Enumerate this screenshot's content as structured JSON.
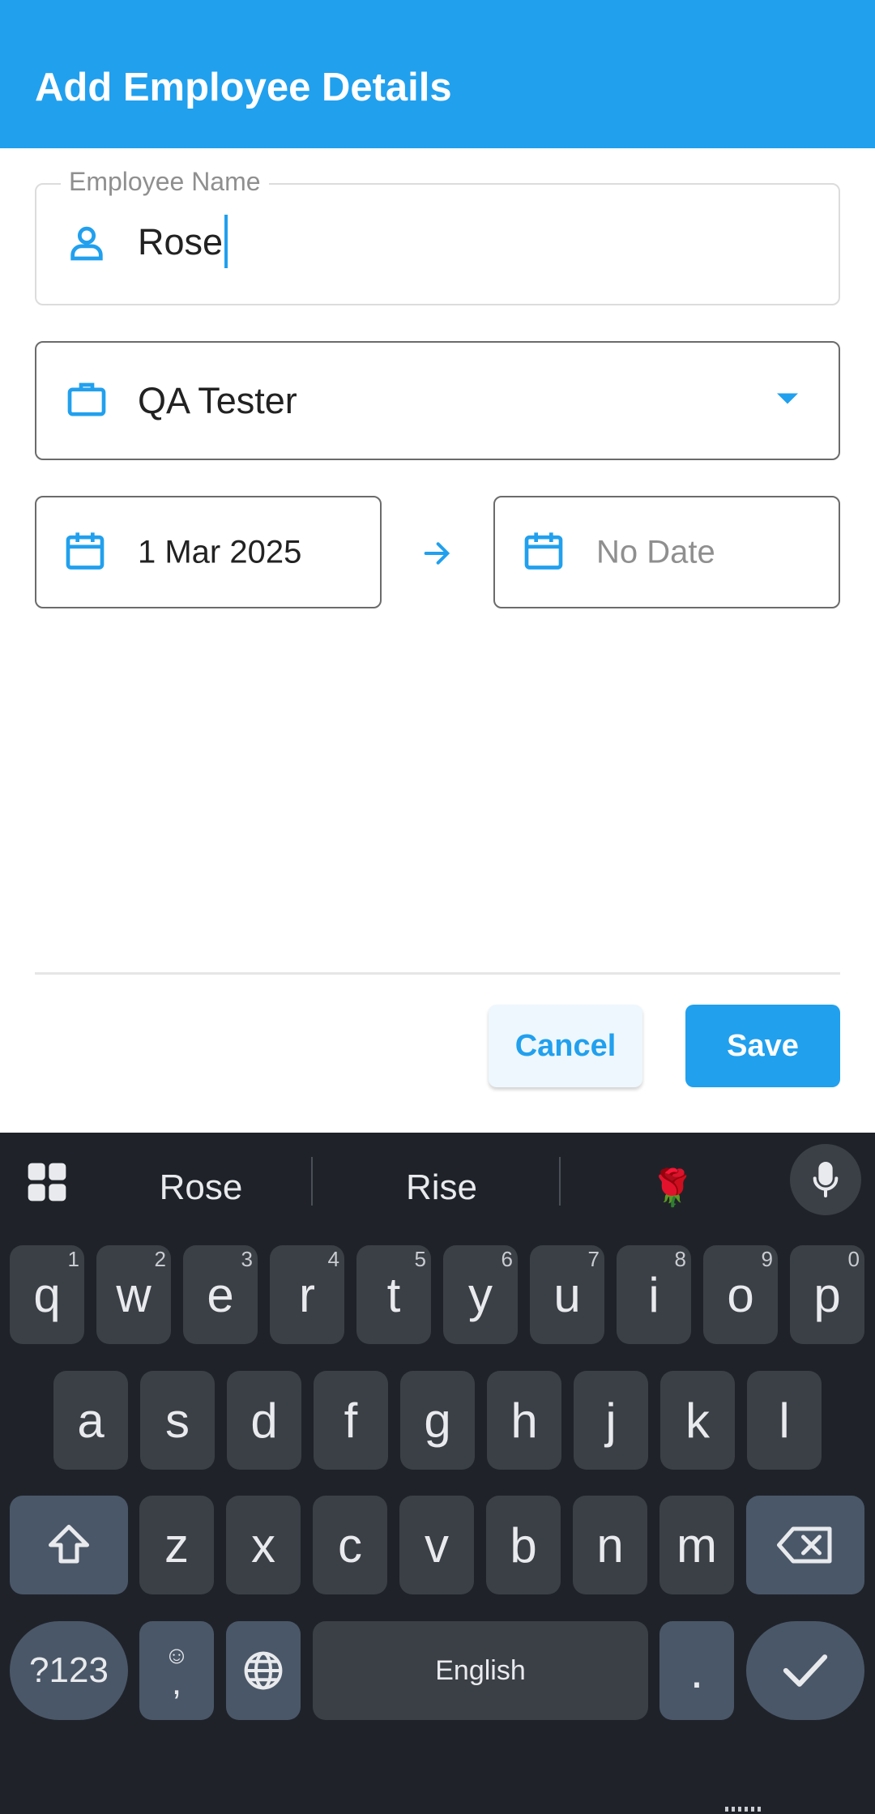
{
  "appbar": {
    "title": "Add Employee Details"
  },
  "name_field": {
    "label": "Employee Name",
    "value": "Rose"
  },
  "role_field": {
    "value": "QA Tester"
  },
  "start_date": {
    "value": "1 Mar 2025"
  },
  "end_date": {
    "placeholder": "No Date"
  },
  "actions": {
    "cancel": "Cancel",
    "save": "Save"
  },
  "colors": {
    "accent": "#21a0ee",
    "keyboard_bg": "#1f2329"
  },
  "keyboard": {
    "suggestions": [
      "Rose",
      "Rise",
      "🌹"
    ],
    "row1": [
      {
        "k": "q",
        "h": "1"
      },
      {
        "k": "w",
        "h": "2"
      },
      {
        "k": "e",
        "h": "3"
      },
      {
        "k": "r",
        "h": "4"
      },
      {
        "k": "t",
        "h": "5"
      },
      {
        "k": "y",
        "h": "6"
      },
      {
        "k": "u",
        "h": "7"
      },
      {
        "k": "i",
        "h": "8"
      },
      {
        "k": "o",
        "h": "9"
      },
      {
        "k": "p",
        "h": "0"
      }
    ],
    "row2": [
      "a",
      "s",
      "d",
      "f",
      "g",
      "h",
      "j",
      "k",
      "l"
    ],
    "row3": [
      "z",
      "x",
      "c",
      "v",
      "b",
      "n",
      "m"
    ],
    "sym_key": "?123",
    "comma_key": ",",
    "space_label": "English",
    "period_key": "."
  }
}
